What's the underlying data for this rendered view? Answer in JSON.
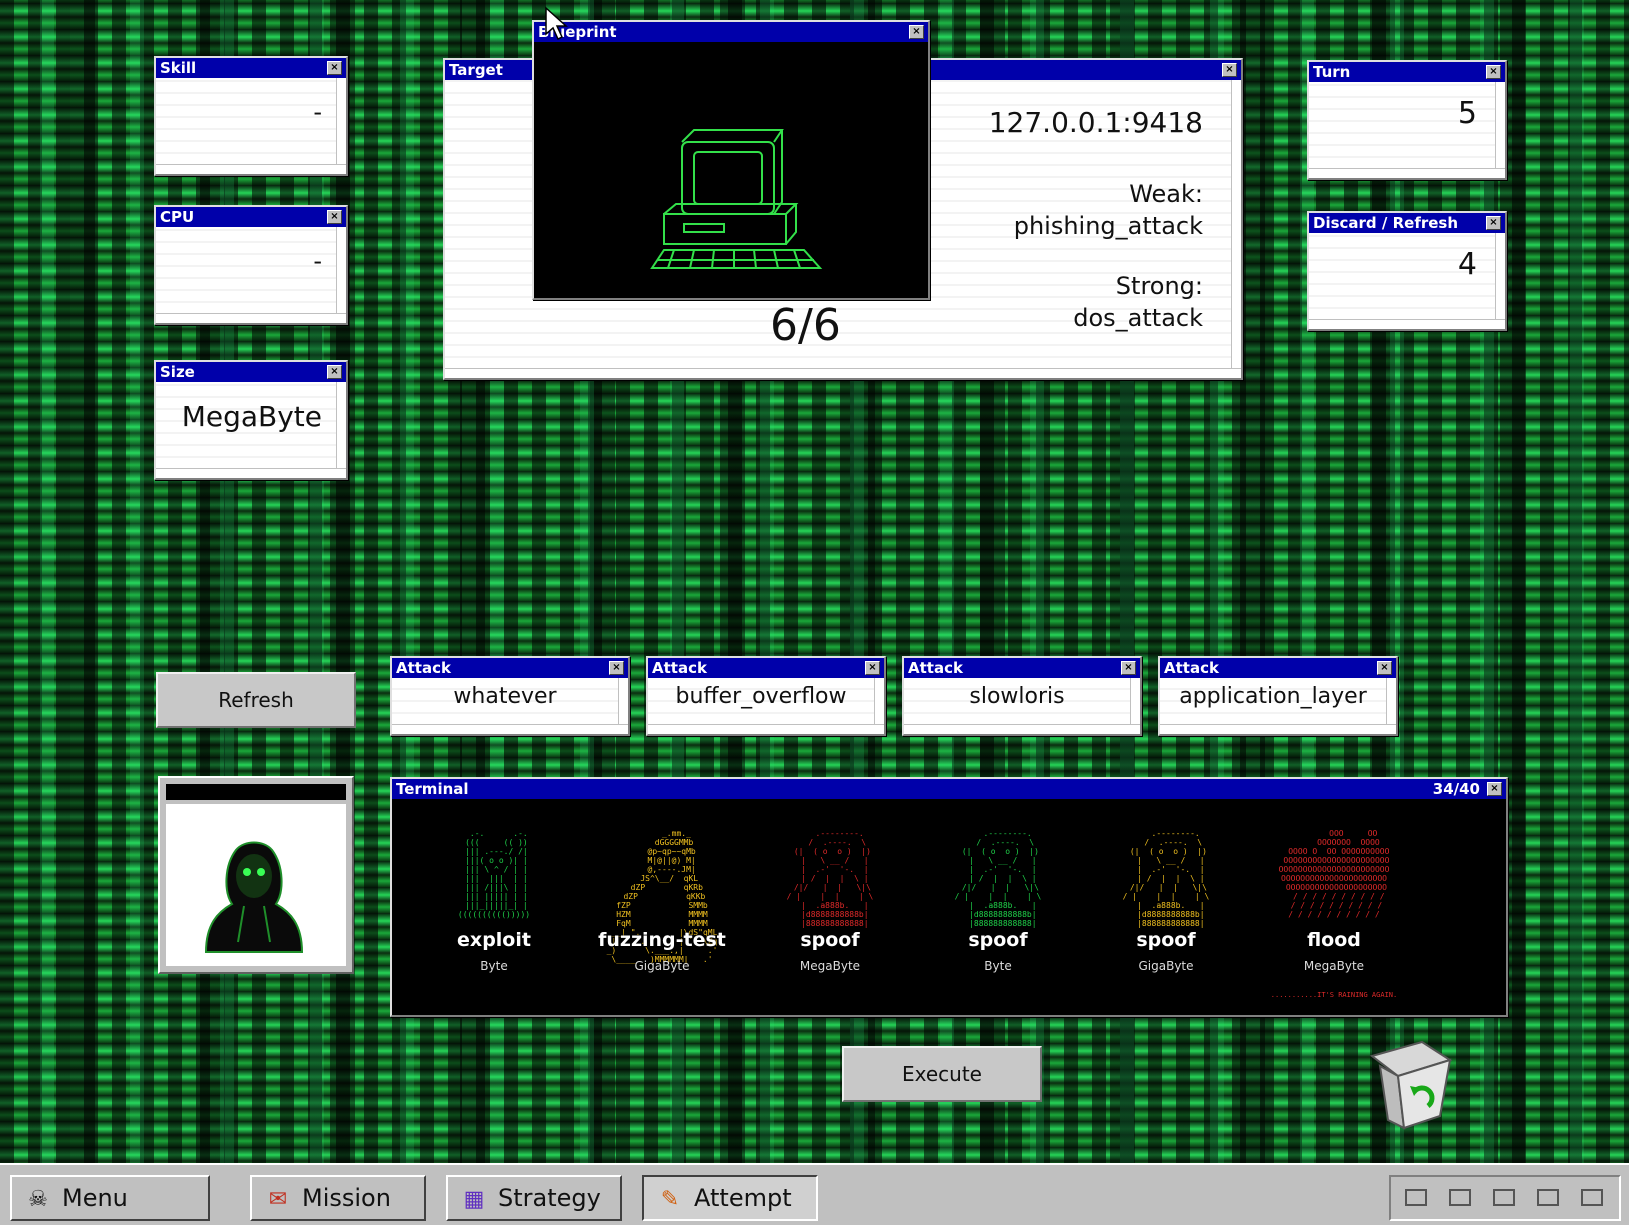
{
  "windows": {
    "skill": {
      "title": "Skill",
      "value": "-"
    },
    "cpu": {
      "title": "CPU",
      "value": "-"
    },
    "size": {
      "title": "Size",
      "value": "MegaByte"
    },
    "target": {
      "title": "Target",
      "address": "127.0.0.1:9418",
      "weak_label": "Weak:",
      "weak_value": "phishing_attack",
      "strong_label": "Strong:",
      "strong_value": "dos_attack",
      "health": "6/6"
    },
    "blueprint": {
      "title": "Blueprint"
    },
    "turn": {
      "title": "Turn",
      "value": "5"
    },
    "discard": {
      "title": "Discard / Refresh",
      "value": "4"
    }
  },
  "attacks": [
    {
      "title": "Attack",
      "value": "whatever"
    },
    {
      "title": "Attack",
      "value": "buffer_overflow"
    },
    {
      "title": "Attack",
      "value": "slowloris"
    },
    {
      "title": "Attack",
      "value": "application_layer"
    }
  ],
  "buttons": {
    "refresh": "Refresh",
    "execute": "Execute"
  },
  "terminal": {
    "title": "Terminal",
    "count": "34/40",
    "cards": [
      {
        "name": "exploit",
        "size": "Byte",
        "color": "#1fd14a"
      },
      {
        "name": "fuzzing-test",
        "size": "GigaByte",
        "color": "#f0c020"
      },
      {
        "name": "spoof",
        "size": "MegaByte",
        "color": "#e02a2a"
      },
      {
        "name": "spoof",
        "size": "Byte",
        "color": "#1fd14a"
      },
      {
        "name": "spoof",
        "size": "GigaByte",
        "color": "#f0c020"
      },
      {
        "name": "flood",
        "size": "MegaByte",
        "color": "#e02a2a",
        "caption": "...........IT'S RAINING AGAIN."
      }
    ]
  },
  "taskbar": {
    "items": [
      {
        "label": "Menu",
        "icon": "skull-icon",
        "glyph": "☠"
      },
      {
        "label": "Mission",
        "icon": "mission-icon",
        "glyph": "✉"
      },
      {
        "label": "Strategy",
        "icon": "strategy-icon",
        "glyph": "▦"
      },
      {
        "label": "Attempt",
        "icon": "attempt-icon",
        "glyph": "✎"
      }
    ]
  }
}
